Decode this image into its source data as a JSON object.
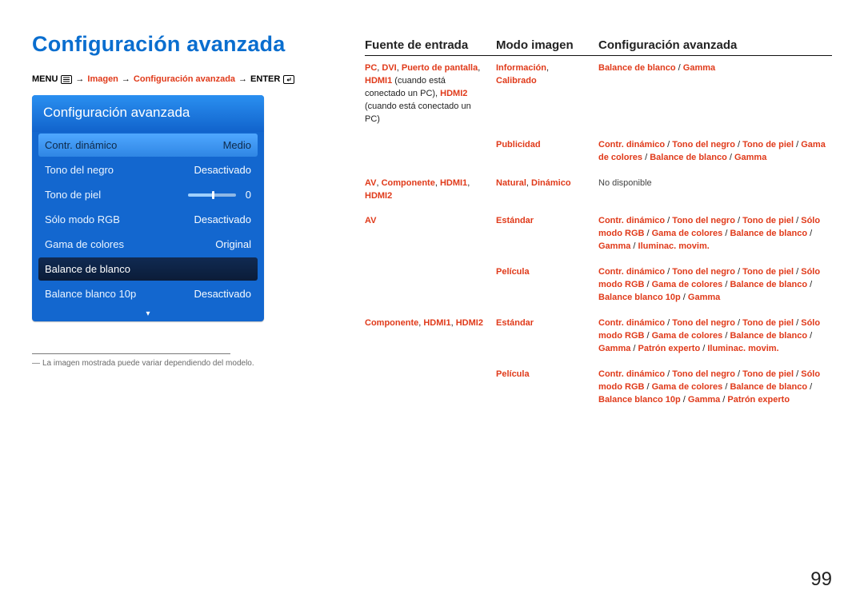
{
  "page_number": "99",
  "title": "Configuración avanzada",
  "breadcrumb": {
    "prefix": "MENU",
    "sep": " → ",
    "seg1": "Imagen",
    "seg2": "Configuración avanzada",
    "suffix": "ENTER"
  },
  "osd": {
    "title": "Configuración avanzada",
    "rows": [
      {
        "label": "Contr. dinámico",
        "value": "Medio",
        "selected": true
      },
      {
        "label": "Tono del negro",
        "value": "Desactivado"
      },
      {
        "label": "Tono de piel",
        "value": "0",
        "slider": true
      },
      {
        "label": "Sólo modo RGB",
        "value": "Desactivado"
      },
      {
        "label": "Gama de colores",
        "value": "Original"
      },
      {
        "label": "Balance de blanco",
        "value": "",
        "highlight": true
      },
      {
        "label": "Balance blanco 10p",
        "value": "Desactivado"
      }
    ]
  },
  "footnote": "La imagen mostrada puede variar dependiendo del modelo.",
  "table": {
    "headers": {
      "c1": "Fuente de entrada",
      "c2": "Modo imagen",
      "c3": "Configuración avanzada"
    },
    "rows": [
      {
        "c1": [
          {
            "t": "PC",
            "c": "red"
          },
          {
            "t": ", ",
            "c": "sep"
          },
          {
            "t": "DVI",
            "c": "red"
          },
          {
            "t": ", ",
            "c": "sep"
          },
          {
            "t": "Puerto de pantalla",
            "c": "red"
          },
          {
            "t": ", ",
            "c": "sep"
          },
          {
            "t": "HDMI1",
            "c": "red"
          },
          {
            "t": " (cuando está conectado un PC), ",
            "c": "note-inline"
          },
          {
            "t": "HDMI2",
            "c": "red"
          },
          {
            "t": " (cuando está conectado un PC)",
            "c": "note-inline"
          }
        ],
        "c2": [
          {
            "t": "Información",
            "c": "red"
          },
          {
            "t": ", ",
            "c": "sep"
          },
          {
            "t": "Calibrado",
            "c": "red"
          }
        ],
        "c3": [
          {
            "t": "Balance de blanco",
            "c": "red"
          },
          {
            "t": " / ",
            "c": "sep"
          },
          {
            "t": "Gamma",
            "c": "red"
          }
        ]
      },
      {
        "c1": [],
        "c2": [
          {
            "t": "Publicidad",
            "c": "red"
          }
        ],
        "c3": [
          {
            "t": "Contr. dinámico",
            "c": "red"
          },
          {
            "t": " / ",
            "c": "sep"
          },
          {
            "t": "Tono del negro",
            "c": "red"
          },
          {
            "t": " / ",
            "c": "sep"
          },
          {
            "t": "Tono de piel",
            "c": "red"
          },
          {
            "t": " / ",
            "c": "sep"
          },
          {
            "t": "Gama de colores",
            "c": "red"
          },
          {
            "t": " / ",
            "c": "sep"
          },
          {
            "t": "Balance de blanco",
            "c": "red"
          },
          {
            "t": " / ",
            "c": "sep"
          },
          {
            "t": "Gamma",
            "c": "red"
          }
        ]
      },
      {
        "c1": [
          {
            "t": "AV",
            "c": "red"
          },
          {
            "t": ", ",
            "c": "sep"
          },
          {
            "t": "Componente",
            "c": "red"
          },
          {
            "t": ", ",
            "c": "sep"
          },
          {
            "t": "HDMI1",
            "c": "red"
          },
          {
            "t": ", ",
            "c": "sep"
          },
          {
            "t": "HDMI2",
            "c": "red"
          }
        ],
        "c2": [
          {
            "t": "Natural",
            "c": "red"
          },
          {
            "t": ", ",
            "c": "sep"
          },
          {
            "t": "Dinámico",
            "c": "red"
          }
        ],
        "c3": [
          {
            "t": "No disponible",
            "c": "na"
          }
        ]
      },
      {
        "c1": [
          {
            "t": "AV",
            "c": "red"
          }
        ],
        "c2": [
          {
            "t": "Estándar",
            "c": "red"
          }
        ],
        "c3": [
          {
            "t": "Contr. dinámico",
            "c": "red"
          },
          {
            "t": " / ",
            "c": "sep"
          },
          {
            "t": "Tono del negro",
            "c": "red"
          },
          {
            "t": " / ",
            "c": "sep"
          },
          {
            "t": "Tono de piel",
            "c": "red"
          },
          {
            "t": " / ",
            "c": "sep"
          },
          {
            "t": "Sólo modo RGB",
            "c": "red"
          },
          {
            "t": " / ",
            "c": "sep"
          },
          {
            "t": "Gama de colores",
            "c": "red"
          },
          {
            "t": " / ",
            "c": "sep"
          },
          {
            "t": "Balance de blanco",
            "c": "red"
          },
          {
            "t": " / ",
            "c": "sep"
          },
          {
            "t": "Gamma",
            "c": "red"
          },
          {
            "t": " / ",
            "c": "sep"
          },
          {
            "t": "Iluminac. movim.",
            "c": "red"
          }
        ]
      },
      {
        "c1": [],
        "c2": [
          {
            "t": "Película",
            "c": "red"
          }
        ],
        "c3": [
          {
            "t": "Contr. dinámico",
            "c": "red"
          },
          {
            "t": " / ",
            "c": "sep"
          },
          {
            "t": "Tono del negro",
            "c": "red"
          },
          {
            "t": " / ",
            "c": "sep"
          },
          {
            "t": "Tono de piel",
            "c": "red"
          },
          {
            "t": " / ",
            "c": "sep"
          },
          {
            "t": "Sólo modo RGB",
            "c": "red"
          },
          {
            "t": " / ",
            "c": "sep"
          },
          {
            "t": "Gama de colores",
            "c": "red"
          },
          {
            "t": " / ",
            "c": "sep"
          },
          {
            "t": "Balance de blanco",
            "c": "red"
          },
          {
            "t": " / ",
            "c": "sep"
          },
          {
            "t": "Balance blanco 10p",
            "c": "red"
          },
          {
            "t": " / ",
            "c": "sep"
          },
          {
            "t": "Gamma",
            "c": "red"
          }
        ]
      },
      {
        "c1": [
          {
            "t": "Componente",
            "c": "red"
          },
          {
            "t": ", ",
            "c": "sep"
          },
          {
            "t": "HDMI1",
            "c": "red"
          },
          {
            "t": ", ",
            "c": "sep"
          },
          {
            "t": "HDMI2",
            "c": "red"
          }
        ],
        "c2": [
          {
            "t": "Estándar",
            "c": "red"
          }
        ],
        "c3": [
          {
            "t": "Contr. dinámico",
            "c": "red"
          },
          {
            "t": " / ",
            "c": "sep"
          },
          {
            "t": "Tono del negro",
            "c": "red"
          },
          {
            "t": " / ",
            "c": "sep"
          },
          {
            "t": "Tono de piel",
            "c": "red"
          },
          {
            "t": " / ",
            "c": "sep"
          },
          {
            "t": "Sólo modo RGB",
            "c": "red"
          },
          {
            "t": " / ",
            "c": "sep"
          },
          {
            "t": "Gama de colores",
            "c": "red"
          },
          {
            "t": " / ",
            "c": "sep"
          },
          {
            "t": "Balance de blanco",
            "c": "red"
          },
          {
            "t": " / ",
            "c": "sep"
          },
          {
            "t": "Gamma",
            "c": "red"
          },
          {
            "t": " / ",
            "c": "sep"
          },
          {
            "t": "Patrón experto",
            "c": "red"
          },
          {
            "t": " / ",
            "c": "sep"
          },
          {
            "t": "Iluminac. movim.",
            "c": "red"
          }
        ]
      },
      {
        "c1": [],
        "c2": [
          {
            "t": "Película",
            "c": "red"
          }
        ],
        "c3": [
          {
            "t": "Contr. dinámico",
            "c": "red"
          },
          {
            "t": " / ",
            "c": "sep"
          },
          {
            "t": "Tono del negro",
            "c": "red"
          },
          {
            "t": " / ",
            "c": "sep"
          },
          {
            "t": "Tono de piel",
            "c": "red"
          },
          {
            "t": " / ",
            "c": "sep"
          },
          {
            "t": "Sólo modo RGB",
            "c": "red"
          },
          {
            "t": " / ",
            "c": "sep"
          },
          {
            "t": "Gama de colores",
            "c": "red"
          },
          {
            "t": " / ",
            "c": "sep"
          },
          {
            "t": "Balance de blanco",
            "c": "red"
          },
          {
            "t": " / ",
            "c": "sep"
          },
          {
            "t": "Balance blanco 10p",
            "c": "red"
          },
          {
            "t": " / ",
            "c": "sep"
          },
          {
            "t": "Gamma",
            "c": "red"
          },
          {
            "t": " / ",
            "c": "sep"
          },
          {
            "t": "Patrón experto",
            "c": "red"
          }
        ]
      }
    ]
  }
}
